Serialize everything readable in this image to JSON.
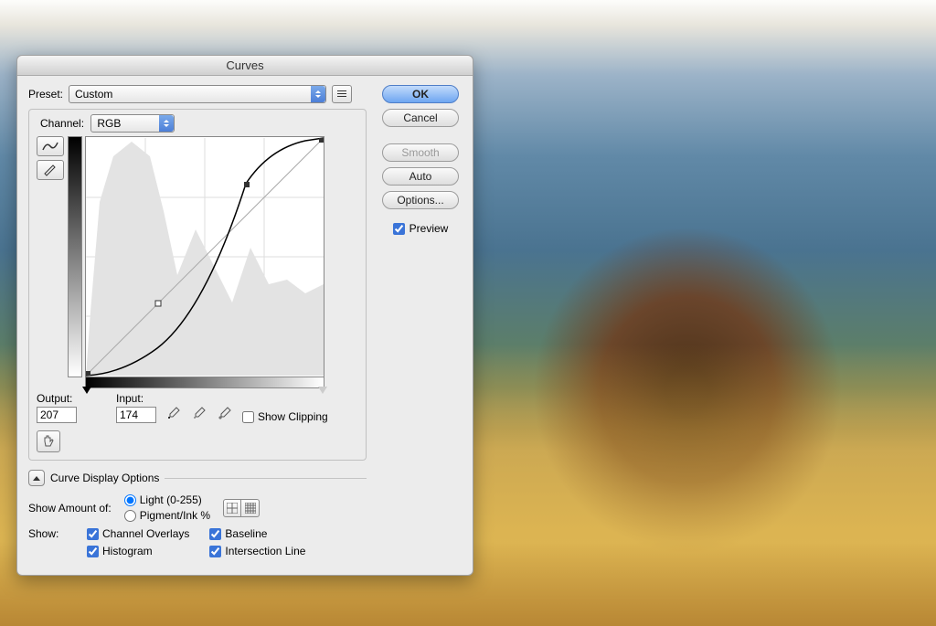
{
  "dialog": {
    "title": "Curves",
    "preset_label": "Preset:",
    "preset_value": "Custom",
    "channel_label": "Channel:",
    "channel_value": "RGB",
    "output_label": "Output:",
    "output_value": "207",
    "input_label": "Input:",
    "input_value": "174",
    "show_clipping_label": "Show Clipping",
    "disclose_label": "Curve Display Options",
    "show_amount_label": "Show Amount of:",
    "radio_light": "Light  (0-255)",
    "radio_pigment": "Pigment/Ink %",
    "show_label": "Show:",
    "checks": {
      "channel_overlays": "Channel Overlays",
      "histogram": "Histogram",
      "baseline": "Baseline",
      "intersection": "Intersection Line"
    }
  },
  "buttons": {
    "ok": "OK",
    "cancel": "Cancel",
    "smooth": "Smooth",
    "auto": "Auto",
    "options": "Options...",
    "preview": "Preview"
  }
}
